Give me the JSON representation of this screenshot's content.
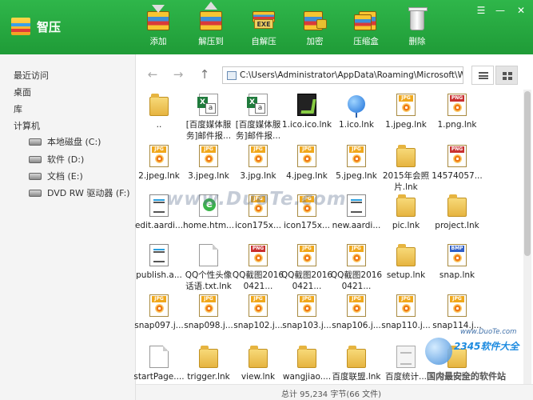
{
  "app": {
    "title": "智压"
  },
  "toolbar": {
    "add": "添加",
    "extract_to": "解压到",
    "sfx": "自解压",
    "encrypt": "加密",
    "compress_box": "压缩盒",
    "delete": "删除",
    "exe_tag": "EXE"
  },
  "window_controls": [
    "menu",
    "minimize",
    "close"
  ],
  "sidebar": {
    "recent": "最近访问",
    "desktop": "桌面",
    "library": "库",
    "computer": "计算机",
    "drives": [
      {
        "label": "本地磁盘 (C:)"
      },
      {
        "label": "软件 (D:)"
      },
      {
        "label": "文档 (E:)"
      },
      {
        "label": "DVD RW 驱动器 (F:)"
      }
    ]
  },
  "nav": {
    "path": "C:\\Users\\Administrator\\AppData\\Roaming\\Microsoft\\W"
  },
  "files": [
    {
      "name": "..",
      "icon": "folder"
    },
    {
      "name": "[百度媒体服务]邮件报...",
      "icon": "excel"
    },
    {
      "name": "[百度媒体服务]邮件报...",
      "icon": "excel"
    },
    {
      "name": "1.ico.ico.lnk",
      "icon": "dark"
    },
    {
      "name": "1.ico.lnk",
      "icon": "ball"
    },
    {
      "name": "1.jpeg.lnk",
      "icon": "jpg",
      "tag": "JPG"
    },
    {
      "name": "1.png.lnk",
      "icon": "png",
      "tag": "PNG"
    },
    {
      "name": "2.jpeg.lnk",
      "icon": "jpg",
      "tag": "JPG"
    },
    {
      "name": "3.jpeg.lnk",
      "icon": "jpg",
      "tag": "JPG"
    },
    {
      "name": "3.jpg.lnk",
      "icon": "jpg",
      "tag": "JPG"
    },
    {
      "name": "4.jpeg.lnk",
      "icon": "jpg",
      "tag": "JPG"
    },
    {
      "name": "5.jpeg.lnk",
      "icon": "jpg",
      "tag": "JPG"
    },
    {
      "name": "2015年会照片.lnk",
      "icon": "folder"
    },
    {
      "name": "14574057...",
      "icon": "png",
      "tag": "PNG"
    },
    {
      "name": "edit.aardi...",
      "icon": "doc"
    },
    {
      "name": "home.htm...",
      "icon": "html"
    },
    {
      "name": "icon175x...",
      "icon": "jpg",
      "tag": "JPG"
    },
    {
      "name": "icon175x...",
      "icon": "jpg",
      "tag": "JPG"
    },
    {
      "name": "new.aardi...",
      "icon": "doc"
    },
    {
      "name": "pic.lnk",
      "icon": "folder"
    },
    {
      "name": "project.lnk",
      "icon": "folder"
    },
    {
      "name": "publish.a...",
      "icon": "doc"
    },
    {
      "name": "QQ个性头像话语.txt.lnk",
      "icon": "blank"
    },
    {
      "name": "QQ截图20160421...",
      "icon": "png",
      "tag": "PNG"
    },
    {
      "name": "QQ截图20160421...",
      "icon": "jpg",
      "tag": "JPG"
    },
    {
      "name": "QQ截图20160421...",
      "icon": "jpg",
      "tag": "JPG"
    },
    {
      "name": "setup.lnk",
      "icon": "folder"
    },
    {
      "name": "snap.lnk",
      "icon": "bmp",
      "tag": "BMP"
    },
    {
      "name": "snap097.j...",
      "icon": "jpg",
      "tag": "JPG"
    },
    {
      "name": "snap098.j...",
      "icon": "jpg",
      "tag": "JPG"
    },
    {
      "name": "snap102.j...",
      "icon": "jpg",
      "tag": "JPG"
    },
    {
      "name": "snap103.j...",
      "icon": "jpg",
      "tag": "JPG"
    },
    {
      "name": "snap106.j...",
      "icon": "jpg",
      "tag": "JPG"
    },
    {
      "name": "snap110.j...",
      "icon": "jpg",
      "tag": "JPG"
    },
    {
      "name": "snap114.j...",
      "icon": "jpg",
      "tag": "JPG"
    },
    {
      "name": "startPage....",
      "icon": "blank"
    },
    {
      "name": "trigger.lnk",
      "icon": "folder"
    },
    {
      "name": "view.lnk",
      "icon": "folder"
    },
    {
      "name": "wangjiao....",
      "icon": "folder"
    },
    {
      "name": "百度联盟.lnk",
      "icon": "folder"
    },
    {
      "name": "百度统计...",
      "icon": "txt"
    },
    {
      "name": "常见问题...",
      "icon": "folder"
    }
  ],
  "status": {
    "text": "总计 95,234 字节(66 文件)"
  },
  "watermark": {
    "text": "www.DuoTe.com",
    "site_url": "www.DuoTe.com",
    "site_name": "2345软件大全",
    "slogan": "国内最安全的软件站"
  }
}
